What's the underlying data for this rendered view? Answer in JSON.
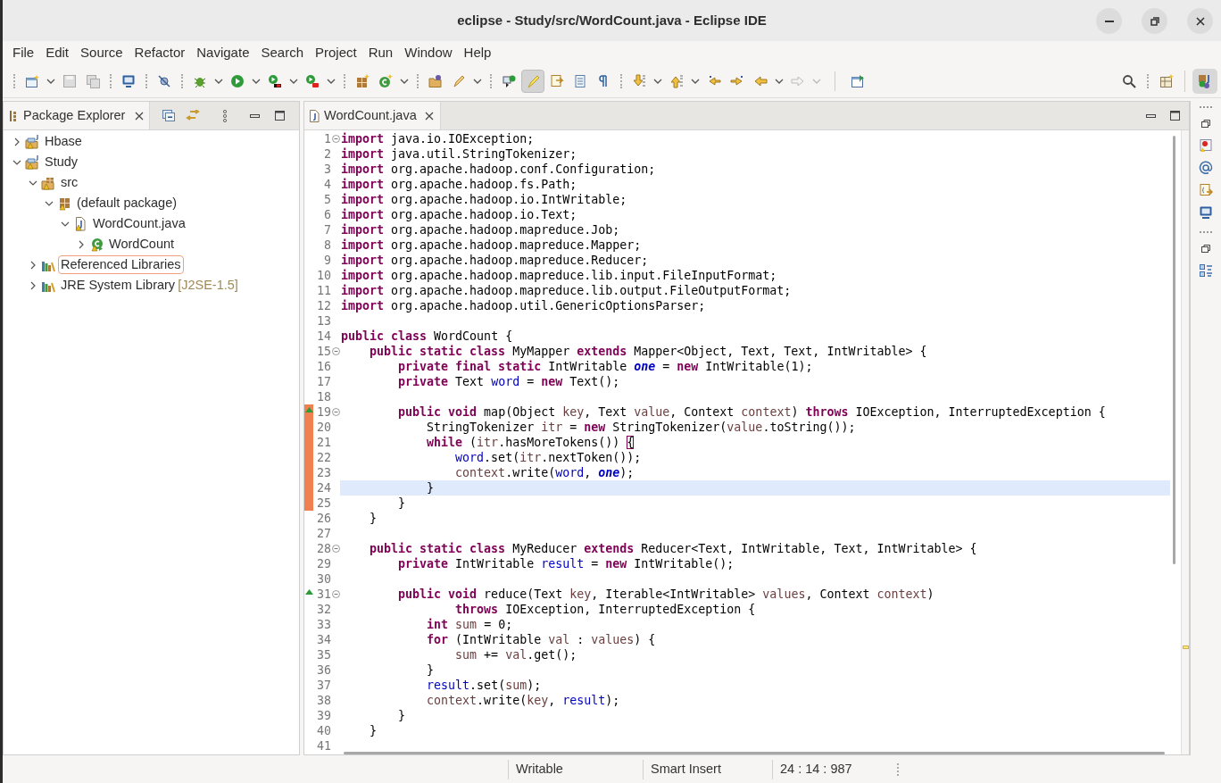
{
  "window": {
    "title": "eclipse - Study/src/WordCount.java - Eclipse IDE"
  },
  "menu": [
    "File",
    "Edit",
    "Source",
    "Refactor",
    "Navigate",
    "Search",
    "Project",
    "Run",
    "Window",
    "Help"
  ],
  "toolbar": {
    "mark_occurrences_on": true
  },
  "explorer": {
    "title": "Package Explorer",
    "tree": [
      {
        "label": "Hbase",
        "kind": "project",
        "expanded": false,
        "selected": false
      },
      {
        "label": "Study",
        "kind": "project",
        "expanded": true,
        "selected": false,
        "children": [
          {
            "label": "src",
            "kind": "source-folder",
            "expanded": true,
            "selected": false,
            "children": [
              {
                "label": "(default package)",
                "kind": "package",
                "expanded": true,
                "selected": false,
                "children": [
                  {
                    "label": "WordCount.java",
                    "kind": "java-file",
                    "expanded": true,
                    "selected": false,
                    "children": [
                      {
                        "label": "WordCount",
                        "kind": "class",
                        "expanded": false,
                        "selected": false
                      }
                    ]
                  }
                ]
              }
            ]
          },
          {
            "label": "Referenced Libraries",
            "kind": "library",
            "expanded": false,
            "selected": true
          },
          {
            "label": "JRE System Library",
            "decoration": "[J2SE-1.5]",
            "kind": "library",
            "expanded": false,
            "selected": false
          }
        ]
      }
    ]
  },
  "editor": {
    "tab": "WordCount.java",
    "lines": [
      {
        "number": "1",
        "fold": true,
        "override": false,
        "changed": false,
        "current": false,
        "tokens": [
          {
            "kind": "keyword",
            "text": "import"
          },
          {
            "kind": "plain",
            "text": " java.io.IOException;"
          }
        ]
      },
      {
        "number": "2",
        "fold": false,
        "override": false,
        "changed": false,
        "current": false,
        "tokens": [
          {
            "kind": "keyword",
            "text": "import"
          },
          {
            "kind": "plain",
            "text": " java.util.StringTokenizer;"
          }
        ]
      },
      {
        "number": "3",
        "fold": false,
        "override": false,
        "changed": false,
        "current": false,
        "tokens": [
          {
            "kind": "keyword",
            "text": "import"
          },
          {
            "kind": "plain",
            "text": " org.apache.hadoop.conf.Configuration;"
          }
        ]
      },
      {
        "number": "4",
        "fold": false,
        "override": false,
        "changed": false,
        "current": false,
        "tokens": [
          {
            "kind": "keyword",
            "text": "import"
          },
          {
            "kind": "plain",
            "text": " org.apache.hadoop.fs.Path;"
          }
        ]
      },
      {
        "number": "5",
        "fold": false,
        "override": false,
        "changed": false,
        "current": false,
        "tokens": [
          {
            "kind": "keyword",
            "text": "import"
          },
          {
            "kind": "plain",
            "text": " org.apache.hadoop.io.IntWritable;"
          }
        ]
      },
      {
        "number": "6",
        "fold": false,
        "override": false,
        "changed": false,
        "current": false,
        "tokens": [
          {
            "kind": "keyword",
            "text": "import"
          },
          {
            "kind": "plain",
            "text": " org.apache.hadoop.io.Text;"
          }
        ]
      },
      {
        "number": "7",
        "fold": false,
        "override": false,
        "changed": false,
        "current": false,
        "tokens": [
          {
            "kind": "keyword",
            "text": "import"
          },
          {
            "kind": "plain",
            "text": " org.apache.hadoop.mapreduce.Job;"
          }
        ]
      },
      {
        "number": "8",
        "fold": false,
        "override": false,
        "changed": false,
        "current": false,
        "tokens": [
          {
            "kind": "keyword",
            "text": "import"
          },
          {
            "kind": "plain",
            "text": " org.apache.hadoop.mapreduce.Mapper;"
          }
        ]
      },
      {
        "number": "9",
        "fold": false,
        "override": false,
        "changed": false,
        "current": false,
        "tokens": [
          {
            "kind": "keyword",
            "text": "import"
          },
          {
            "kind": "plain",
            "text": " org.apache.hadoop.mapreduce.Reducer;"
          }
        ]
      },
      {
        "number": "10",
        "fold": false,
        "override": false,
        "changed": false,
        "current": false,
        "tokens": [
          {
            "kind": "keyword",
            "text": "import"
          },
          {
            "kind": "plain",
            "text": " org.apache.hadoop.mapreduce.lib.input.FileInputFormat;"
          }
        ]
      },
      {
        "number": "11",
        "fold": false,
        "override": false,
        "changed": false,
        "current": false,
        "tokens": [
          {
            "kind": "keyword",
            "text": "import"
          },
          {
            "kind": "plain",
            "text": " org.apache.hadoop.mapreduce.lib.output.FileOutputFormat;"
          }
        ]
      },
      {
        "number": "12",
        "fold": false,
        "override": false,
        "changed": false,
        "current": false,
        "tokens": [
          {
            "kind": "keyword",
            "text": "import"
          },
          {
            "kind": "plain",
            "text": " org.apache.hadoop.util.GenericOptionsParser;"
          }
        ]
      },
      {
        "number": "13",
        "fold": false,
        "override": false,
        "changed": false,
        "current": false
      },
      {
        "number": "14",
        "fold": false,
        "override": false,
        "changed": false,
        "current": false,
        "tokens": [
          {
            "kind": "keyword",
            "text": "public class"
          },
          {
            "kind": "plain",
            "text": " WordCount {"
          }
        ]
      },
      {
        "number": "15",
        "fold": true,
        "override": false,
        "changed": false,
        "current": false,
        "tokens": [
          {
            "kind": "keyword",
            "text": "    public static class"
          },
          {
            "kind": "plain",
            "text": " MyMapper "
          },
          {
            "kind": "keyword",
            "text": "extends"
          },
          {
            "kind": "plain",
            "text": " Mapper<Object, Text, Text, IntWritable> {"
          }
        ]
      },
      {
        "number": "16",
        "fold": false,
        "override": false,
        "changed": false,
        "current": false,
        "tokens": [
          {
            "kind": "keyword",
            "text": "        private final static"
          },
          {
            "kind": "plain",
            "text": " IntWritable "
          },
          {
            "kind": "static-field",
            "text": "one"
          },
          {
            "kind": "plain",
            "text": " = "
          },
          {
            "kind": "keyword",
            "text": "new"
          },
          {
            "kind": "plain",
            "text": " IntWritable(1);"
          }
        ]
      },
      {
        "number": "17",
        "fold": false,
        "override": false,
        "changed": false,
        "current": false,
        "tokens": [
          {
            "kind": "keyword",
            "text": "        private"
          },
          {
            "kind": "plain",
            "text": " Text "
          },
          {
            "kind": "field",
            "text": "word"
          },
          {
            "kind": "plain",
            "text": " = "
          },
          {
            "kind": "keyword",
            "text": "new"
          },
          {
            "kind": "plain",
            "text": " Text();"
          }
        ]
      },
      {
        "number": "18",
        "fold": false,
        "override": false,
        "changed": false,
        "current": false
      },
      {
        "number": "19",
        "fold": true,
        "override": true,
        "changed": true,
        "current": false,
        "tokens": [
          {
            "kind": "keyword",
            "text": "        public void"
          },
          {
            "kind": "plain",
            "text": " map(Object "
          },
          {
            "kind": "variable",
            "text": "key"
          },
          {
            "kind": "plain",
            "text": ", Text "
          },
          {
            "kind": "variable",
            "text": "value"
          },
          {
            "kind": "plain",
            "text": ", Context "
          },
          {
            "kind": "variable",
            "text": "context"
          },
          {
            "kind": "plain",
            "text": ") "
          },
          {
            "kind": "keyword",
            "text": "throws"
          },
          {
            "kind": "plain",
            "text": " IOException, InterruptedException {"
          }
        ]
      },
      {
        "number": "20",
        "fold": false,
        "override": false,
        "changed": true,
        "current": false,
        "tokens": [
          {
            "kind": "plain",
            "text": "            StringTokenizer "
          },
          {
            "kind": "variable",
            "text": "itr"
          },
          {
            "kind": "plain",
            "text": " = "
          },
          {
            "kind": "keyword",
            "text": "new"
          },
          {
            "kind": "plain",
            "text": " StringTokenizer("
          },
          {
            "kind": "variable",
            "text": "value"
          },
          {
            "kind": "plain",
            "text": ".toString());"
          }
        ]
      },
      {
        "number": "21",
        "fold": false,
        "override": false,
        "changed": true,
        "current": false,
        "tokens": [
          {
            "kind": "keyword",
            "text": "            while"
          },
          {
            "kind": "plain",
            "text": " ("
          },
          {
            "kind": "variable",
            "text": "itr"
          },
          {
            "kind": "plain",
            "text": ".hasMoreTokens()) "
          },
          {
            "kind": "bracket",
            "text": "{"
          }
        ]
      },
      {
        "number": "22",
        "fold": false,
        "override": false,
        "changed": true,
        "current": false,
        "tokens": [
          {
            "kind": "field",
            "text": "                word"
          },
          {
            "kind": "plain",
            "text": ".set("
          },
          {
            "kind": "variable",
            "text": "itr"
          },
          {
            "kind": "plain",
            "text": ".nextToken());"
          }
        ]
      },
      {
        "number": "23",
        "fold": false,
        "override": false,
        "changed": true,
        "current": false,
        "tokens": [
          {
            "kind": "variable",
            "text": "                context"
          },
          {
            "kind": "plain",
            "text": ".write("
          },
          {
            "kind": "field",
            "text": "word"
          },
          {
            "kind": "plain",
            "text": ", "
          },
          {
            "kind": "static-field",
            "text": "one"
          },
          {
            "kind": "plain",
            "text": ");"
          }
        ]
      },
      {
        "number": "24",
        "fold": false,
        "override": false,
        "changed": true,
        "current": true,
        "tokens": [
          {
            "kind": "plain",
            "text": "            }"
          }
        ]
      },
      {
        "number": "25",
        "fold": false,
        "override": false,
        "changed": true,
        "current": false,
        "tokens": [
          {
            "kind": "plain",
            "text": "        }"
          }
        ]
      },
      {
        "number": "26",
        "fold": false,
        "override": false,
        "changed": false,
        "current": false,
        "tokens": [
          {
            "kind": "plain",
            "text": "    }"
          }
        ]
      },
      {
        "number": "27",
        "fold": false,
        "override": false,
        "changed": false,
        "current": false
      },
      {
        "number": "28",
        "fold": true,
        "override": false,
        "changed": false,
        "current": false,
        "tokens": [
          {
            "kind": "keyword",
            "text": "    public static class"
          },
          {
            "kind": "plain",
            "text": " MyReducer "
          },
          {
            "kind": "keyword",
            "text": "extends"
          },
          {
            "kind": "plain",
            "text": " Reducer<Text, IntWritable, Text, IntWritable> {"
          }
        ]
      },
      {
        "number": "29",
        "fold": false,
        "override": false,
        "changed": false,
        "current": false,
        "tokens": [
          {
            "kind": "keyword",
            "text": "        private"
          },
          {
            "kind": "plain",
            "text": " IntWritable "
          },
          {
            "kind": "field",
            "text": "result"
          },
          {
            "kind": "plain",
            "text": " = "
          },
          {
            "kind": "keyword",
            "text": "new"
          },
          {
            "kind": "plain",
            "text": " IntWritable();"
          }
        ]
      },
      {
        "number": "30",
        "fold": false,
        "override": false,
        "changed": false,
        "current": false
      },
      {
        "number": "31",
        "fold": true,
        "override": true,
        "changed": false,
        "current": false,
        "tokens": [
          {
            "kind": "keyword",
            "text": "        public void"
          },
          {
            "kind": "plain",
            "text": " reduce(Text "
          },
          {
            "kind": "variable",
            "text": "key"
          },
          {
            "kind": "plain",
            "text": ", Iterable<IntWritable> "
          },
          {
            "kind": "variable",
            "text": "values"
          },
          {
            "kind": "plain",
            "text": ", Context "
          },
          {
            "kind": "variable",
            "text": "context"
          },
          {
            "kind": "plain",
            "text": ")"
          }
        ]
      },
      {
        "number": "32",
        "fold": false,
        "override": false,
        "changed": false,
        "current": false,
        "tokens": [
          {
            "kind": "keyword",
            "text": "                throws"
          },
          {
            "kind": "plain",
            "text": " IOException, InterruptedException {"
          }
        ]
      },
      {
        "number": "33",
        "fold": false,
        "override": false,
        "changed": false,
        "current": false,
        "tokens": [
          {
            "kind": "keyword",
            "text": "            int"
          },
          {
            "kind": "variable",
            "text": " sum"
          },
          {
            "kind": "plain",
            "text": " = 0;"
          }
        ]
      },
      {
        "number": "34",
        "fold": false,
        "override": false,
        "changed": false,
        "current": false,
        "tokens": [
          {
            "kind": "keyword",
            "text": "            for"
          },
          {
            "kind": "plain",
            "text": " (IntWritable "
          },
          {
            "kind": "variable",
            "text": "val"
          },
          {
            "kind": "plain",
            "text": " : "
          },
          {
            "kind": "variable",
            "text": "values"
          },
          {
            "kind": "plain",
            "text": ") {"
          }
        ]
      },
      {
        "number": "35",
        "fold": false,
        "override": false,
        "changed": false,
        "current": false,
        "tokens": [
          {
            "kind": "variable",
            "text": "                sum"
          },
          {
            "kind": "plain",
            "text": " += "
          },
          {
            "kind": "variable",
            "text": "val"
          },
          {
            "kind": "plain",
            "text": ".get();"
          }
        ]
      },
      {
        "number": "36",
        "fold": false,
        "override": false,
        "changed": false,
        "current": false,
        "tokens": [
          {
            "kind": "plain",
            "text": "            }"
          }
        ]
      },
      {
        "number": "37",
        "fold": false,
        "override": false,
        "changed": false,
        "current": false,
        "tokens": [
          {
            "kind": "field",
            "text": "            result"
          },
          {
            "kind": "plain",
            "text": ".set("
          },
          {
            "kind": "variable",
            "text": "sum"
          },
          {
            "kind": "plain",
            "text": ");"
          }
        ]
      },
      {
        "number": "38",
        "fold": false,
        "override": false,
        "changed": false,
        "current": false,
        "tokens": [
          {
            "kind": "variable",
            "text": "            context"
          },
          {
            "kind": "plain",
            "text": ".write("
          },
          {
            "kind": "variable",
            "text": "key"
          },
          {
            "kind": "plain",
            "text": ", "
          },
          {
            "kind": "field",
            "text": "result"
          },
          {
            "kind": "plain",
            "text": ");"
          }
        ]
      },
      {
        "number": "39",
        "fold": false,
        "override": false,
        "changed": false,
        "current": false,
        "tokens": [
          {
            "kind": "plain",
            "text": "        }"
          }
        ]
      },
      {
        "number": "40",
        "fold": false,
        "override": false,
        "changed": false,
        "current": false,
        "tokens": [
          {
            "kind": "plain",
            "text": "    }"
          }
        ]
      },
      {
        "number": "41",
        "fold": false,
        "override": false,
        "changed": false,
        "current": false
      }
    ]
  },
  "status_bar": [
    "Writable",
    "Smart Insert",
    "24 : 14 : 987"
  ]
}
